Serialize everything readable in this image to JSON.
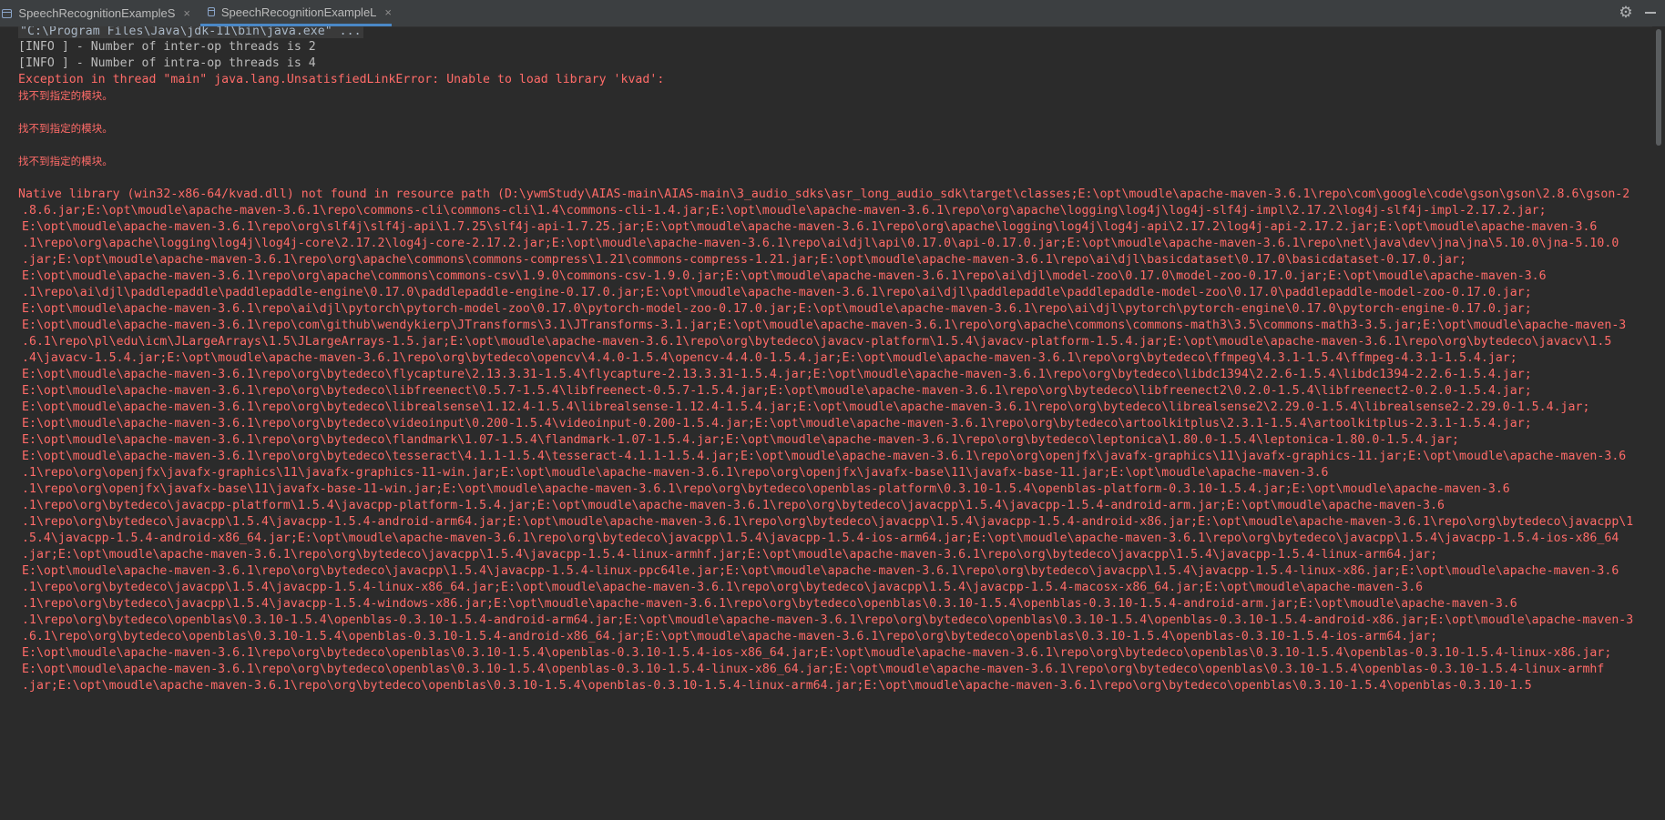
{
  "tabs": [
    {
      "label": "SpeechRecognitionExampleS",
      "close": "×",
      "active": false
    },
    {
      "label": "SpeechRecognitionExampleL",
      "close": "×",
      "active": true
    }
  ],
  "toolbar": {
    "settings_icon": "gear-icon",
    "minimize_icon": "minus-icon"
  },
  "console": {
    "command": "\"C:\\Program Files\\Java\\jdk-11\\bin\\java.exe\" ...",
    "info": [
      "[INFO ] - Number of inter-op threads is 2",
      "[INFO ] - Number of intra-op threads is 4"
    ],
    "exception": "Exception in thread \"main\" java.lang.UnsatisfiedLinkError: Unable to load library 'kvad':",
    "not_found_messages": [
      "找不到指定的模块。",
      "找不到指定的模块。",
      "找不到指定的模块。"
    ],
    "native_lines": [
      "Native library (win32-x86-64/kvad.dll) not found in resource path (D:\\ywmStudy\\AIAS-main\\AIAS-main\\3_audio_sdks\\asr_long_audio_sdk\\target\\classes;E:\\opt\\moudle\\apache-maven-3.6.1\\repo\\com\\google\\code\\gson\\gson\\2.8.6\\gson-2",
      ".8.6.jar;E:\\opt\\moudle\\apache-maven-3.6.1\\repo\\commons-cli\\commons-cli\\1.4\\commons-cli-1.4.jar;E:\\opt\\moudle\\apache-maven-3.6.1\\repo\\org\\apache\\logging\\log4j\\log4j-slf4j-impl\\2.17.2\\log4j-slf4j-impl-2.17.2.jar;",
      "E:\\opt\\moudle\\apache-maven-3.6.1\\repo\\org\\slf4j\\slf4j-api\\1.7.25\\slf4j-api-1.7.25.jar;E:\\opt\\moudle\\apache-maven-3.6.1\\repo\\org\\apache\\logging\\log4j\\log4j-api\\2.17.2\\log4j-api-2.17.2.jar;E:\\opt\\moudle\\apache-maven-3.6",
      ".1\\repo\\org\\apache\\logging\\log4j\\log4j-core\\2.17.2\\log4j-core-2.17.2.jar;E:\\opt\\moudle\\apache-maven-3.6.1\\repo\\ai\\djl\\api\\0.17.0\\api-0.17.0.jar;E:\\opt\\moudle\\apache-maven-3.6.1\\repo\\net\\java\\dev\\jna\\jna\\5.10.0\\jna-5.10.0",
      ".jar;E:\\opt\\moudle\\apache-maven-3.6.1\\repo\\org\\apache\\commons\\commons-compress\\1.21\\commons-compress-1.21.jar;E:\\opt\\moudle\\apache-maven-3.6.1\\repo\\ai\\djl\\basicdataset\\0.17.0\\basicdataset-0.17.0.jar;",
      "E:\\opt\\moudle\\apache-maven-3.6.1\\repo\\org\\apache\\commons\\commons-csv\\1.9.0\\commons-csv-1.9.0.jar;E:\\opt\\moudle\\apache-maven-3.6.1\\repo\\ai\\djl\\model-zoo\\0.17.0\\model-zoo-0.17.0.jar;E:\\opt\\moudle\\apache-maven-3.6",
      ".1\\repo\\ai\\djl\\paddlepaddle\\paddlepaddle-engine\\0.17.0\\paddlepaddle-engine-0.17.0.jar;E:\\opt\\moudle\\apache-maven-3.6.1\\repo\\ai\\djl\\paddlepaddle\\paddlepaddle-model-zoo\\0.17.0\\paddlepaddle-model-zoo-0.17.0.jar;",
      "E:\\opt\\moudle\\apache-maven-3.6.1\\repo\\ai\\djl\\pytorch\\pytorch-model-zoo\\0.17.0\\pytorch-model-zoo-0.17.0.jar;E:\\opt\\moudle\\apache-maven-3.6.1\\repo\\ai\\djl\\pytorch\\pytorch-engine\\0.17.0\\pytorch-engine-0.17.0.jar;",
      "E:\\opt\\moudle\\apache-maven-3.6.1\\repo\\com\\github\\wendykierp\\JTransforms\\3.1\\JTransforms-3.1.jar;E:\\opt\\moudle\\apache-maven-3.6.1\\repo\\org\\apache\\commons\\commons-math3\\3.5\\commons-math3-3.5.jar;E:\\opt\\moudle\\apache-maven-3",
      ".6.1\\repo\\pl\\edu\\icm\\JLargeArrays\\1.5\\JLargeArrays-1.5.jar;E:\\opt\\moudle\\apache-maven-3.6.1\\repo\\org\\bytedeco\\javacv-platform\\1.5.4\\javacv-platform-1.5.4.jar;E:\\opt\\moudle\\apache-maven-3.6.1\\repo\\org\\bytedeco\\javacv\\1.5",
      ".4\\javacv-1.5.4.jar;E:\\opt\\moudle\\apache-maven-3.6.1\\repo\\org\\bytedeco\\opencv\\4.4.0-1.5.4\\opencv-4.4.0-1.5.4.jar;E:\\opt\\moudle\\apache-maven-3.6.1\\repo\\org\\bytedeco\\ffmpeg\\4.3.1-1.5.4\\ffmpeg-4.3.1-1.5.4.jar;",
      "E:\\opt\\moudle\\apache-maven-3.6.1\\repo\\org\\bytedeco\\flycapture\\2.13.3.31-1.5.4\\flycapture-2.13.3.31-1.5.4.jar;E:\\opt\\moudle\\apache-maven-3.6.1\\repo\\org\\bytedeco\\libdc1394\\2.2.6-1.5.4\\libdc1394-2.2.6-1.5.4.jar;",
      "E:\\opt\\moudle\\apache-maven-3.6.1\\repo\\org\\bytedeco\\libfreenect\\0.5.7-1.5.4\\libfreenect-0.5.7-1.5.4.jar;E:\\opt\\moudle\\apache-maven-3.6.1\\repo\\org\\bytedeco\\libfreenect2\\0.2.0-1.5.4\\libfreenect2-0.2.0-1.5.4.jar;",
      "E:\\opt\\moudle\\apache-maven-3.6.1\\repo\\org\\bytedeco\\librealsense\\1.12.4-1.5.4\\librealsense-1.12.4-1.5.4.jar;E:\\opt\\moudle\\apache-maven-3.6.1\\repo\\org\\bytedeco\\librealsense2\\2.29.0-1.5.4\\librealsense2-2.29.0-1.5.4.jar;",
      "E:\\opt\\moudle\\apache-maven-3.6.1\\repo\\org\\bytedeco\\videoinput\\0.200-1.5.4\\videoinput-0.200-1.5.4.jar;E:\\opt\\moudle\\apache-maven-3.6.1\\repo\\org\\bytedeco\\artoolkitplus\\2.3.1-1.5.4\\artoolkitplus-2.3.1-1.5.4.jar;",
      "E:\\opt\\moudle\\apache-maven-3.6.1\\repo\\org\\bytedeco\\flandmark\\1.07-1.5.4\\flandmark-1.07-1.5.4.jar;E:\\opt\\moudle\\apache-maven-3.6.1\\repo\\org\\bytedeco\\leptonica\\1.80.0-1.5.4\\leptonica-1.80.0-1.5.4.jar;",
      "E:\\opt\\moudle\\apache-maven-3.6.1\\repo\\org\\bytedeco\\tesseract\\4.1.1-1.5.4\\tesseract-4.1.1-1.5.4.jar;E:\\opt\\moudle\\apache-maven-3.6.1\\repo\\org\\openjfx\\javafx-graphics\\11\\javafx-graphics-11.jar;E:\\opt\\moudle\\apache-maven-3.6",
      ".1\\repo\\org\\openjfx\\javafx-graphics\\11\\javafx-graphics-11-win.jar;E:\\opt\\moudle\\apache-maven-3.6.1\\repo\\org\\openjfx\\javafx-base\\11\\javafx-base-11.jar;E:\\opt\\moudle\\apache-maven-3.6",
      ".1\\repo\\org\\openjfx\\javafx-base\\11\\javafx-base-11-win.jar;E:\\opt\\moudle\\apache-maven-3.6.1\\repo\\org\\bytedeco\\openblas-platform\\0.3.10-1.5.4\\openblas-platform-0.3.10-1.5.4.jar;E:\\opt\\moudle\\apache-maven-3.6",
      ".1\\repo\\org\\bytedeco\\javacpp-platform\\1.5.4\\javacpp-platform-1.5.4.jar;E:\\opt\\moudle\\apache-maven-3.6.1\\repo\\org\\bytedeco\\javacpp\\1.5.4\\javacpp-1.5.4-android-arm.jar;E:\\opt\\moudle\\apache-maven-3.6",
      ".1\\repo\\org\\bytedeco\\javacpp\\1.5.4\\javacpp-1.5.4-android-arm64.jar;E:\\opt\\moudle\\apache-maven-3.6.1\\repo\\org\\bytedeco\\javacpp\\1.5.4\\javacpp-1.5.4-android-x86.jar;E:\\opt\\moudle\\apache-maven-3.6.1\\repo\\org\\bytedeco\\javacpp\\1",
      ".5.4\\javacpp-1.5.4-android-x86_64.jar;E:\\opt\\moudle\\apache-maven-3.6.1\\repo\\org\\bytedeco\\javacpp\\1.5.4\\javacpp-1.5.4-ios-arm64.jar;E:\\opt\\moudle\\apache-maven-3.6.1\\repo\\org\\bytedeco\\javacpp\\1.5.4\\javacpp-1.5.4-ios-x86_64",
      ".jar;E:\\opt\\moudle\\apache-maven-3.6.1\\repo\\org\\bytedeco\\javacpp\\1.5.4\\javacpp-1.5.4-linux-armhf.jar;E:\\opt\\moudle\\apache-maven-3.6.1\\repo\\org\\bytedeco\\javacpp\\1.5.4\\javacpp-1.5.4-linux-arm64.jar;",
      "E:\\opt\\moudle\\apache-maven-3.6.1\\repo\\org\\bytedeco\\javacpp\\1.5.4\\javacpp-1.5.4-linux-ppc64le.jar;E:\\opt\\moudle\\apache-maven-3.6.1\\repo\\org\\bytedeco\\javacpp\\1.5.4\\javacpp-1.5.4-linux-x86.jar;E:\\opt\\moudle\\apache-maven-3.6",
      ".1\\repo\\org\\bytedeco\\javacpp\\1.5.4\\javacpp-1.5.4-linux-x86_64.jar;E:\\opt\\moudle\\apache-maven-3.6.1\\repo\\org\\bytedeco\\javacpp\\1.5.4\\javacpp-1.5.4-macosx-x86_64.jar;E:\\opt\\moudle\\apache-maven-3.6",
      ".1\\repo\\org\\bytedeco\\javacpp\\1.5.4\\javacpp-1.5.4-windows-x86.jar;E:\\opt\\moudle\\apache-maven-3.6.1\\repo\\org\\bytedeco\\openblas\\0.3.10-1.5.4\\openblas-0.3.10-1.5.4-android-arm.jar;E:\\opt\\moudle\\apache-maven-3.6",
      ".1\\repo\\org\\bytedeco\\openblas\\0.3.10-1.5.4\\openblas-0.3.10-1.5.4-android-arm64.jar;E:\\opt\\moudle\\apache-maven-3.6.1\\repo\\org\\bytedeco\\openblas\\0.3.10-1.5.4\\openblas-0.3.10-1.5.4-android-x86.jar;E:\\opt\\moudle\\apache-maven-3",
      ".6.1\\repo\\org\\bytedeco\\openblas\\0.3.10-1.5.4\\openblas-0.3.10-1.5.4-android-x86_64.jar;E:\\opt\\moudle\\apache-maven-3.6.1\\repo\\org\\bytedeco\\openblas\\0.3.10-1.5.4\\openblas-0.3.10-1.5.4-ios-arm64.jar;",
      "E:\\opt\\moudle\\apache-maven-3.6.1\\repo\\org\\bytedeco\\openblas\\0.3.10-1.5.4\\openblas-0.3.10-1.5.4-ios-x86_64.jar;E:\\opt\\moudle\\apache-maven-3.6.1\\repo\\org\\bytedeco\\openblas\\0.3.10-1.5.4\\openblas-0.3.10-1.5.4-linux-x86.jar;",
      "E:\\opt\\moudle\\apache-maven-3.6.1\\repo\\org\\bytedeco\\openblas\\0.3.10-1.5.4\\openblas-0.3.10-1.5.4-linux-x86_64.jar;E:\\opt\\moudle\\apache-maven-3.6.1\\repo\\org\\bytedeco\\openblas\\0.3.10-1.5.4\\openblas-0.3.10-1.5.4-linux-armhf",
      ".jar;E:\\opt\\moudle\\apache-maven-3.6.1\\repo\\org\\bytedeco\\openblas\\0.3.10-1.5.4\\openblas-0.3.10-1.5.4-linux-arm64.jar;E:\\opt\\moudle\\apache-maven-3.6.1\\repo\\org\\bytedeco\\openblas\\0.3.10-1.5.4\\openblas-0.3.10-1.5"
    ]
  },
  "colors": {
    "background": "#2b2b2b",
    "tabbar": "#3c3f41",
    "error": "#ff6b68",
    "info": "#bbbbbb",
    "active_tab_underline": "#4a88c7"
  }
}
